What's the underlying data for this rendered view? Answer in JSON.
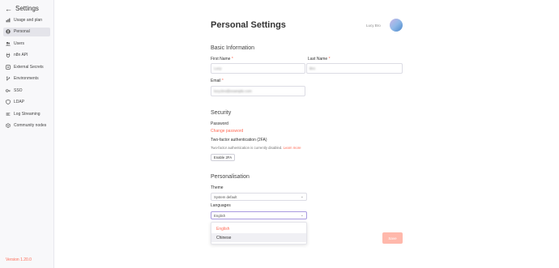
{
  "sidebar": {
    "back_icon": "arrow-left-icon",
    "title": "Settings",
    "items": [
      {
        "label": "Usage and plan",
        "icon": "chart-icon"
      },
      {
        "label": "Personal",
        "icon": "user-circle-icon",
        "active": true
      },
      {
        "label": "Users",
        "icon": "users-icon"
      },
      {
        "label": "n8n API",
        "icon": "plug-icon"
      },
      {
        "label": "External Secrets",
        "icon": "vault-icon"
      },
      {
        "label": "Environments",
        "icon": "branch-icon"
      },
      {
        "label": "SSO",
        "icon": "key-icon"
      },
      {
        "label": "LDAP",
        "icon": "shield-icon"
      },
      {
        "label": "Log Streaming",
        "icon": "stream-icon"
      },
      {
        "label": "Community nodes",
        "icon": "cube-icon"
      }
    ],
    "version": "Version 1.20.0"
  },
  "header": {
    "title": "Personal Settings",
    "user_name": "Lucy Bro"
  },
  "basic": {
    "title": "Basic Information",
    "first_name_label": "First Name",
    "first_name_value": "Lucy",
    "last_name_label": "Last Name",
    "last_name_value": "Bro",
    "email_label": "Email",
    "email_value": "lucy.bro@example.com",
    "required_mark": "*"
  },
  "security": {
    "title": "Security",
    "password_label": "Password",
    "change_password": "Change password",
    "tfa_label": "Two-factor authentication (2FA)",
    "tfa_status": "Two-factor authentication is currently disabled.",
    "learn_more": "Learn more",
    "enable_button": "Enable 2FA"
  },
  "personalisation": {
    "title": "Personalisation",
    "theme_label": "Theme",
    "theme_value": "System default",
    "languages_label": "Languages",
    "languages_value": "English",
    "language_options": [
      "English",
      "Chinese"
    ],
    "selected_language": "English"
  },
  "save_button": "Save",
  "colors": {
    "accent": "#ff6a55",
    "save_disabled": "#ffb8ab"
  }
}
